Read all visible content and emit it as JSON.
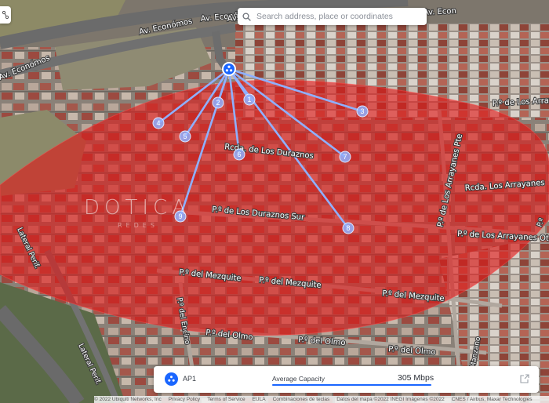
{
  "search": {
    "placeholder": "Search address, place or coordinates"
  },
  "map": {
    "streets": [
      "Av. Económos",
      "Av. Económos",
      "Av. Económos",
      "Av. Econó",
      "Av. Econ",
      "Rcda. de Los Duraznos",
      "P.º de Los Duraznos Sur",
      "Rcda. Los Arrayanes",
      "P.º de Los Arrayanes Pte",
      "P.º de Los Arrayanes Ote",
      "P.º de Los Array",
      "P.º del Mezquite",
      "P.º del Mezquite",
      "P.º del Mezquite",
      "P.º del Olmo",
      "P.º del Olmo",
      "P.º del Olmo",
      "P.º del Manzano",
      "P.º del Encino",
      "Lateral Perif.",
      "Lateral Perif.",
      "P.º"
    ],
    "access_point": {
      "name": "AP1"
    },
    "client_markers": [
      "1",
      "2",
      "3",
      "4",
      "5",
      "6",
      "7",
      "8",
      "9"
    ],
    "colors": {
      "coverage": "#e01818",
      "accent": "#1a66ff",
      "link": "#8fb0ff"
    }
  },
  "watermark": {
    "brand": "DOTICA",
    "tagline": "REDES"
  },
  "panel": {
    "ap_label": "AP1",
    "capacity_label": "Average Capacity",
    "capacity_value": "305 Mbps",
    "capacity_fraction": 1.0
  },
  "attribution": [
    "© 2022 Ubiquiti Networks, Inc",
    "Privacy Policy",
    "Terms of Service",
    "EULA",
    "Combinaciones de teclas",
    "Datos del mapa ©2022 INEGI Imágenes ©2022",
    "CNES / Airbus, Maxar Technologies"
  ]
}
